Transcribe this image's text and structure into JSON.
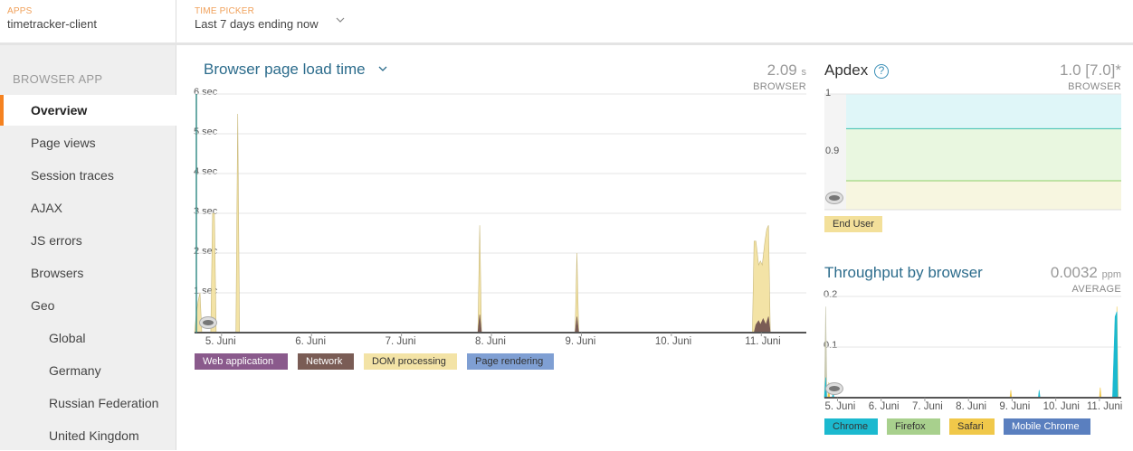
{
  "topbar": {
    "apps_label": "APPS",
    "app_name": "timetracker-client",
    "time_label": "TIME PICKER",
    "time_value": "Last 7 days ending now"
  },
  "sidebar": {
    "heading": "BROWSER APP",
    "items": [
      {
        "label": "Overview",
        "active": true
      },
      {
        "label": "Page views"
      },
      {
        "label": "Session traces"
      },
      {
        "label": "AJAX"
      },
      {
        "label": "JS errors"
      },
      {
        "label": "Browsers"
      },
      {
        "label": "Geo"
      },
      {
        "label": "Global",
        "sub": true
      },
      {
        "label": "Germany",
        "sub": true
      },
      {
        "label": "Russian Federation",
        "sub": true
      },
      {
        "label": "United Kingdom",
        "sub": true
      }
    ]
  },
  "load_panel": {
    "title": "Browser page load time",
    "value": "2.09",
    "unit": "s",
    "caption": "BROWSER",
    "legend": [
      {
        "label": "Web application",
        "color": "#8a5a8c"
      },
      {
        "label": "Network",
        "color": "#7a5c55"
      },
      {
        "label": "DOM processing",
        "color": "#f3e3a6"
      },
      {
        "label": "Page rendering",
        "color": "#7f9fd3"
      }
    ]
  },
  "apdex_panel": {
    "title": "Apdex",
    "help_icon": "question-circle-icon",
    "value": "1.0 [7.0]*",
    "caption": "BROWSER",
    "legend": [
      {
        "label": "End User",
        "color": "#f3e09a"
      }
    ]
  },
  "throughput_panel": {
    "title": "Throughput by browser",
    "value": "0.0032",
    "unit": "ppm",
    "caption": "AVERAGE",
    "legend": [
      {
        "label": "Chrome",
        "color": "#1bb9cf"
      },
      {
        "label": "Firefox",
        "color": "#a8d08d"
      },
      {
        "label": "Safari",
        "color": "#f0c84a"
      },
      {
        "label": "Mobile Chrome",
        "color": "#5a7fbf"
      }
    ]
  },
  "chart_data": [
    {
      "type": "area",
      "title": "Browser page load time",
      "y_unit": "sec",
      "ylim": [
        0,
        6
      ],
      "y_ticks": [
        "6 sec",
        "5 sec",
        "4 sec",
        "3 sec",
        "2 sec",
        "1 sec"
      ],
      "x_ticks": [
        "5. Juni",
        "6. Juni",
        "7. Juni",
        "8. Juni",
        "9. Juni",
        "10. Juni",
        "11. Juni"
      ],
      "x_range_days": [
        4.7,
        11.5
      ],
      "series": [
        {
          "name": "DOM processing",
          "color": "#f3e3a6",
          "points": [
            [
              4.7,
              0
            ],
            [
              4.72,
              0.5
            ],
            [
              4.74,
              0.8
            ],
            [
              4.76,
              1.0
            ],
            [
              4.78,
              0
            ],
            [
              4.88,
              0
            ],
            [
              4.9,
              3.0
            ],
            [
              4.92,
              3.0
            ],
            [
              4.94,
              0
            ],
            [
              5.16,
              0
            ],
            [
              5.18,
              5.5
            ],
            [
              5.2,
              0
            ],
            [
              7.85,
              0
            ],
            [
              7.87,
              2.7
            ],
            [
              7.89,
              0
            ],
            [
              8.93,
              0
            ],
            [
              8.95,
              2.0
            ],
            [
              8.97,
              0
            ],
            [
              10.9,
              0
            ],
            [
              10.92,
              2.3
            ],
            [
              10.94,
              2.3
            ],
            [
              10.97,
              1.7
            ],
            [
              10.99,
              1.8
            ],
            [
              11.01,
              1.7
            ],
            [
              11.04,
              2.3
            ],
            [
              11.06,
              2.6
            ],
            [
              11.08,
              2.7
            ],
            [
              11.1,
              0
            ]
          ]
        },
        {
          "name": "Network",
          "color": "#7a5c55",
          "points": [
            [
              4.7,
              0
            ],
            [
              7.85,
              0
            ],
            [
              7.87,
              0.45
            ],
            [
              7.89,
              0
            ],
            [
              8.93,
              0
            ],
            [
              8.95,
              0.4
            ],
            [
              8.97,
              0
            ],
            [
              10.92,
              0
            ],
            [
              10.94,
              0.2
            ],
            [
              10.97,
              0.3
            ],
            [
              10.99,
              0.2
            ],
            [
              11.02,
              0.35
            ],
            [
              11.05,
              0.2
            ],
            [
              11.08,
              0.4
            ],
            [
              11.1,
              0
            ]
          ]
        }
      ],
      "marker_day": 4.72
    },
    {
      "type": "area",
      "title": "Apdex",
      "ylim": [
        0.8,
        1.0
      ],
      "y_ticks": [
        "1",
        "0.9"
      ],
      "bands": [
        {
          "from": 0.94,
          "to": 1.0,
          "color": "#dff6f8"
        },
        {
          "from": 0.85,
          "to": 0.94,
          "color": "#e9f7e0"
        },
        {
          "from": 0.8,
          "to": 0.85,
          "color": "#f7f6e0"
        }
      ]
    },
    {
      "type": "area",
      "title": "Throughput by browser",
      "ylim": [
        0,
        0.2
      ],
      "y_ticks": [
        "0.2",
        "0.1"
      ],
      "x_ticks": [
        "5. Juni",
        "6. Juni",
        "7. Juni",
        "8. Juni",
        "9. Juni",
        "10. Juni",
        "11. Juni"
      ],
      "x_range_days": [
        4.7,
        11.5
      ],
      "series": [
        {
          "name": "Firefox",
          "color": "#c9c9b0",
          "points": [
            [
              4.7,
              0
            ],
            [
              4.73,
              0.18
            ],
            [
              4.76,
              0
            ]
          ]
        },
        {
          "name": "Safari",
          "color": "#f0c84a",
          "points": [
            [
              4.78,
              0
            ],
            [
              4.8,
              0.03
            ],
            [
              4.82,
              0
            ],
            [
              8.95,
              0
            ],
            [
              8.97,
              0.015
            ],
            [
              8.99,
              0
            ],
            [
              11.0,
              0
            ],
            [
              11.02,
              0.02
            ],
            [
              11.04,
              0
            ],
            [
              11.38,
              0
            ],
            [
              11.4,
              0.18
            ],
            [
              11.43,
              0
            ]
          ]
        },
        {
          "name": "Chrome",
          "color": "#1bb9cf",
          "points": [
            [
              4.7,
              0
            ],
            [
              4.73,
              0.04
            ],
            [
              4.75,
              0
            ],
            [
              4.88,
              0
            ],
            [
              4.9,
              0.01
            ],
            [
              4.92,
              0
            ],
            [
              9.6,
              0
            ],
            [
              9.62,
              0.015
            ],
            [
              9.64,
              0
            ],
            [
              11.3,
              0
            ],
            [
              11.36,
              0.16
            ],
            [
              11.4,
              0.17
            ],
            [
              11.42,
              0
            ]
          ]
        }
      ]
    }
  ]
}
